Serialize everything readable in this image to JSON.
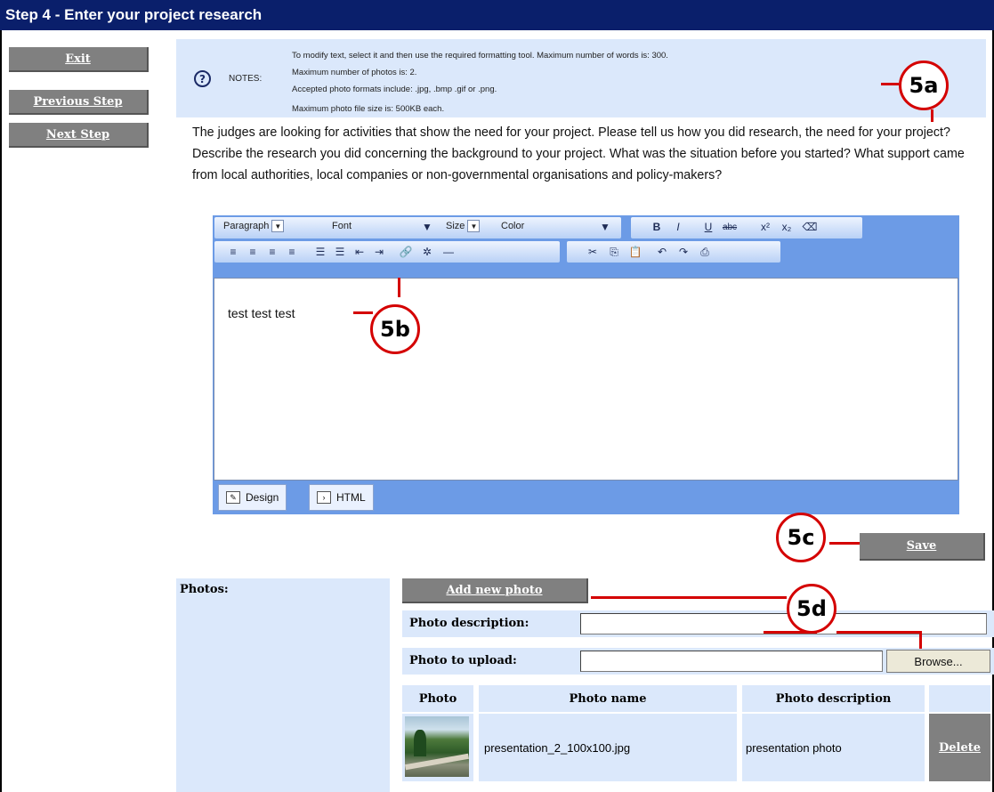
{
  "header": {
    "title": "Step 4 - Enter your project research"
  },
  "nav": {
    "exit": "Exit",
    "previous": "Previous Step",
    "next": "Next Step"
  },
  "notes": {
    "label": "NOTES:",
    "lines": [
      "To modify text, select it and then use the required formatting tool. Maximum number of words is: 300.",
      "Maximum number of photos is: 2.",
      "Accepted photo formats include: .jpg, .bmp .gif or .png.",
      "Maximum photo file size is: 500KB each."
    ]
  },
  "intro": "The judges are looking for activities that show the need for your project. Please tell us how you did research, the need for your project? Describe the research you did concerning the background to your project. What was the situation before you started? What support came from local authorities, local companies or non-governmental organisations and policy-makers?",
  "editor": {
    "selects": {
      "paragraph": "Paragraph",
      "font": "Font",
      "size": "Size",
      "color": "Color"
    },
    "content": "test test test",
    "tabs": {
      "design": "Design",
      "html": "HTML"
    }
  },
  "callouts": {
    "a": "5a",
    "b": "5b",
    "c": "5c",
    "d": "5d"
  },
  "save_label": "Save",
  "photos": {
    "label": "Photos:",
    "add_button": "Add new photo",
    "description_label": "Photo description:",
    "upload_label": "Photo to upload:",
    "browse_label": "Browse...",
    "columns": [
      "Photo",
      "Photo name",
      "Photo description"
    ],
    "rows": [
      {
        "name": "presentation_2_100x100.jpg",
        "description": "presentation photo",
        "delete_label": "Delete"
      }
    ]
  },
  "colors": {
    "title_bar": "#0a1f6b",
    "panel": "#dbe8fb",
    "button": "#808080",
    "callout": "#d40000",
    "toolbar": "#6c9be6"
  }
}
